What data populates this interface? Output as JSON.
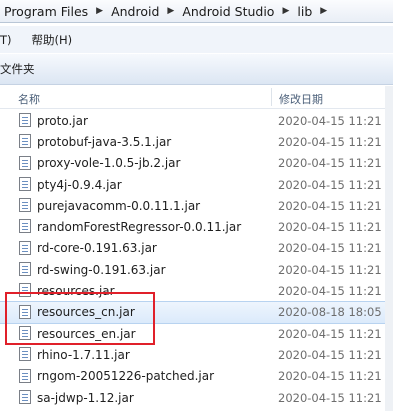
{
  "breadcrumb": [
    "Program Files",
    "Android",
    "Android Studio",
    "lib"
  ],
  "menu": {
    "tools_partial": "T)",
    "help": "帮助(H)"
  },
  "toolbar": {
    "new_folder_partial": "文件夹"
  },
  "columns": {
    "name": "名称",
    "modified": "修改日期"
  },
  "files": [
    {
      "name": "proto.jar",
      "date": "2020-04-15 11:21"
    },
    {
      "name": "protobuf-java-3.5.1.jar",
      "date": "2020-04-15 11:21"
    },
    {
      "name": "proxy-vole-1.0.5-jb.2.jar",
      "date": "2020-04-15 11:21"
    },
    {
      "name": "pty4j-0.9.4.jar",
      "date": "2020-04-15 11:21"
    },
    {
      "name": "purejavacomm-0.0.11.1.jar",
      "date": "2020-04-15 11:21"
    },
    {
      "name": "randomForestRegressor-0.0.11.jar",
      "date": "2020-04-15 11:21"
    },
    {
      "name": "rd-core-0.191.63.jar",
      "date": "2020-04-15 11:21"
    },
    {
      "name": "rd-swing-0.191.63.jar",
      "date": "2020-04-15 11:21"
    },
    {
      "name": "resources.jar",
      "date": "2020-04-15 11:21"
    },
    {
      "name": "resources_cn.jar",
      "date": "2020-08-18 18:05"
    },
    {
      "name": "resources_en.jar",
      "date": "2020-04-15 11:21"
    },
    {
      "name": "rhino-1.7.11.jar",
      "date": "2020-04-15 11:21"
    },
    {
      "name": "rngom-20051226-patched.jar",
      "date": "2020-04-15 11:21"
    },
    {
      "name": "sa-jdwp-1.12.jar",
      "date": "2020-04-15 11:21"
    }
  ],
  "selected_file": "resources_cn.jar",
  "highlight_color": "#e0202a"
}
